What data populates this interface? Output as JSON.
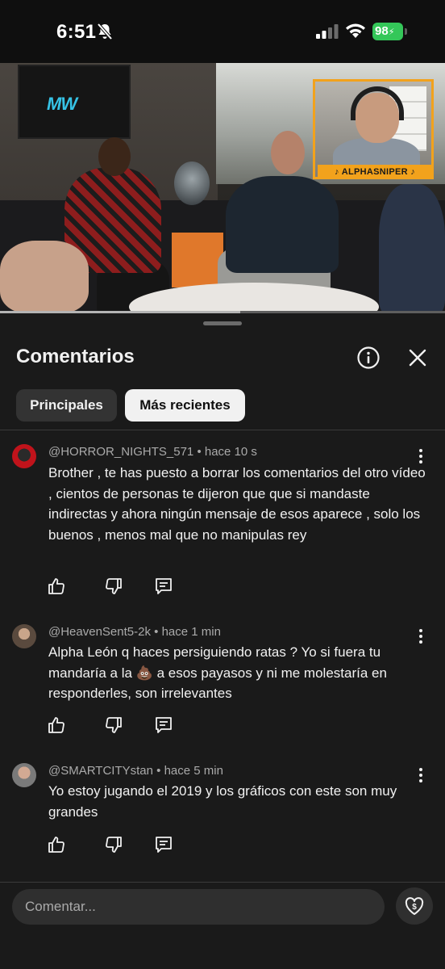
{
  "status_bar": {
    "time": "6:51",
    "battery": "98"
  },
  "video": {
    "tv_logo": "MW",
    "streamer_banner": "ALPHASNIPER",
    "progress": 0.54
  },
  "panel": {
    "title": "Comentarios",
    "chips": [
      "Principales",
      "Más recientes"
    ],
    "selected_chip": "Más recientes"
  },
  "comments": [
    {
      "author": "@HORROR_NIGHTS_571",
      "time": "hace 10 s",
      "text": "Brother , te has puesto a borrar los comentarios del otro vídeo , cientos de personas te dijeron que que si mandaste indirectas y ahora ningún mensaje de esos aparece , solo los buenos , menos mal que no manipulas rey"
    },
    {
      "author": "@HeavenSent5-2k",
      "time": "hace 1 min",
      "text": "Alpha León q haces persiguiendo ratas ? Yo si fuera tu mandaría a la 💩 a esos payasos y ni me molestaría en responderles, son irrelevantes"
    },
    {
      "author": "@SMARTCITYstan",
      "time": "hace 5 min",
      "text": "Yo estoy jugando el 2019 y los gráficos con este son muy grandes"
    }
  ],
  "composer": {
    "placeholder": "Comentar..."
  },
  "colors": {
    "battery": "#34c759",
    "panel_bg": "#1a1a1a",
    "chip_selected_bg": "#f1f1f1",
    "streamer_accent": "#f2a21c"
  }
}
